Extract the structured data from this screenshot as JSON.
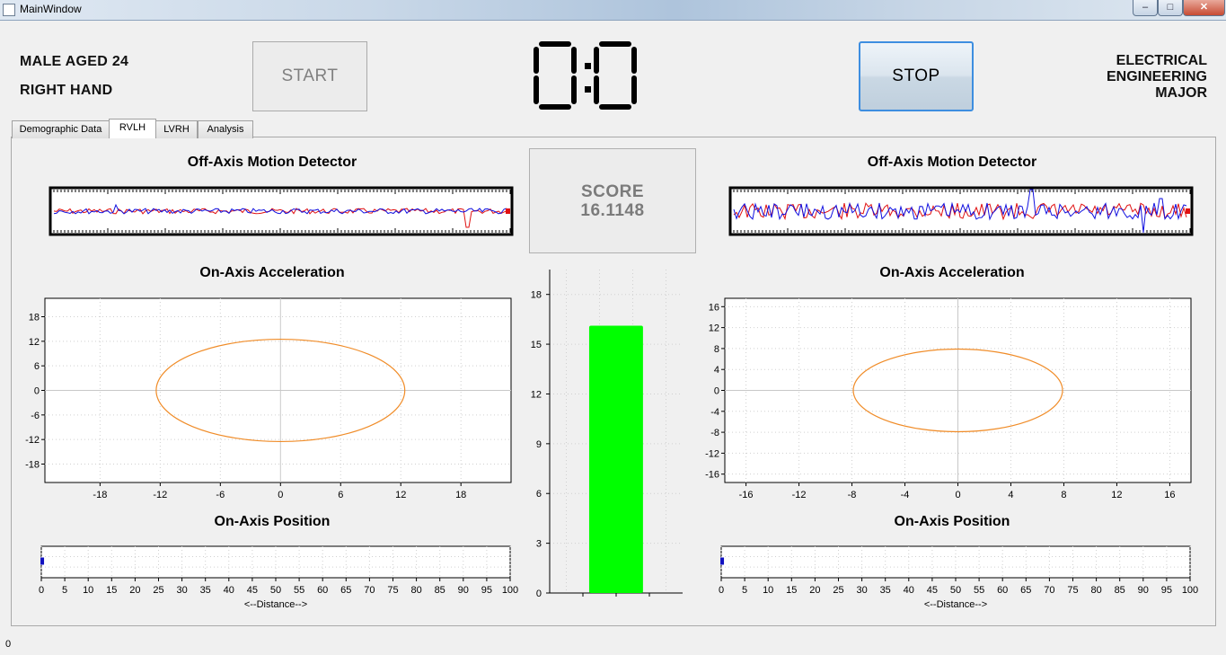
{
  "window": {
    "title": "MainWindow",
    "minimize": "–",
    "maximize": "□",
    "close": "✕"
  },
  "header": {
    "subject_line1": "MALE AGED 24",
    "subject_line2": "RIGHT HAND",
    "start_label": "START",
    "stop_label": "STOP",
    "timer": "0:0",
    "major_line1": "ELECTRICAL",
    "major_line2": "ENGINEERING",
    "major_line3": "MAJOR"
  },
  "tabs": [
    "Demographic Data",
    "RVLH",
    "LVRH",
    "Analysis"
  ],
  "active_tab": "RVLH",
  "titles": {
    "off_axis_left": "Off-Axis Motion Detector",
    "off_axis_right": "Off-Axis Motion Detector",
    "on_accel_left": "On-Axis Acceleration",
    "on_accel_right": "On-Axis Acceleration",
    "on_pos_left": "On-Axis Position",
    "on_pos_right": "On-Axis Position"
  },
  "score": {
    "label": "SCORE",
    "value": "16.1148"
  },
  "status": {
    "text": "0"
  },
  "icons": {
    "app": "window-icon"
  },
  "colors": {
    "ellipse": "#f08c28",
    "bar": "#00ff00",
    "trace_red": "#e01010",
    "trace_blue": "#1010e0"
  },
  "chart_data": [
    {
      "type": "line",
      "name": "left-off-axis",
      "series_colors": [
        "red",
        "blue"
      ]
    },
    {
      "type": "scatter",
      "name": "left-acceleration",
      "shape": "ellipse",
      "x_ticks": [
        -18,
        -12,
        -6,
        0,
        6,
        12,
        18
      ],
      "y_ticks": [
        18,
        12,
        6,
        0,
        -6,
        -12,
        -18
      ],
      "xlim": [
        -23.5,
        23
      ],
      "ylim": [
        -22.5,
        22.5
      ],
      "center": [
        0,
        0
      ],
      "radius_x": 12.4,
      "radius_y": 12.5
    },
    {
      "type": "scatter",
      "name": "left-position",
      "xlabel": "<--Distance-->",
      "x_ticks": [
        0,
        5,
        10,
        15,
        20,
        25,
        30,
        35,
        40,
        45,
        50,
        55,
        60,
        65,
        70,
        75,
        80,
        85,
        90,
        95,
        100
      ],
      "xlim": [
        0,
        100
      ],
      "points": [
        [
          0.2,
          0.5
        ]
      ]
    },
    {
      "type": "bar",
      "name": "score-bar",
      "values": [
        16.1148
      ],
      "ylim": [
        0,
        19.5
      ],
      "y_ticks": [
        0,
        3,
        6,
        9,
        12,
        15,
        18
      ]
    },
    {
      "type": "line",
      "name": "right-off-axis",
      "series_colors": [
        "red",
        "blue"
      ]
    },
    {
      "type": "scatter",
      "name": "right-acceleration",
      "shape": "ellipse",
      "x_ticks": [
        -16,
        -12,
        -8,
        -4,
        0,
        4,
        8,
        12,
        16
      ],
      "y_ticks": [
        16,
        12,
        8,
        4,
        0,
        -4,
        -8,
        -12,
        -16
      ],
      "xlim": [
        -17.6,
        17.6
      ],
      "ylim": [
        -17.6,
        17.6
      ],
      "center": [
        0,
        0
      ],
      "radius_x": 7.9,
      "radius_y": 7.9
    },
    {
      "type": "scatter",
      "name": "right-position",
      "xlabel": "<--Distance-->",
      "x_ticks": [
        0,
        5,
        10,
        15,
        20,
        25,
        30,
        35,
        40,
        45,
        50,
        55,
        60,
        65,
        70,
        75,
        80,
        85,
        90,
        95,
        100
      ],
      "xlim": [
        0,
        100
      ],
      "points": [
        [
          0.2,
          0.5
        ]
      ]
    }
  ]
}
